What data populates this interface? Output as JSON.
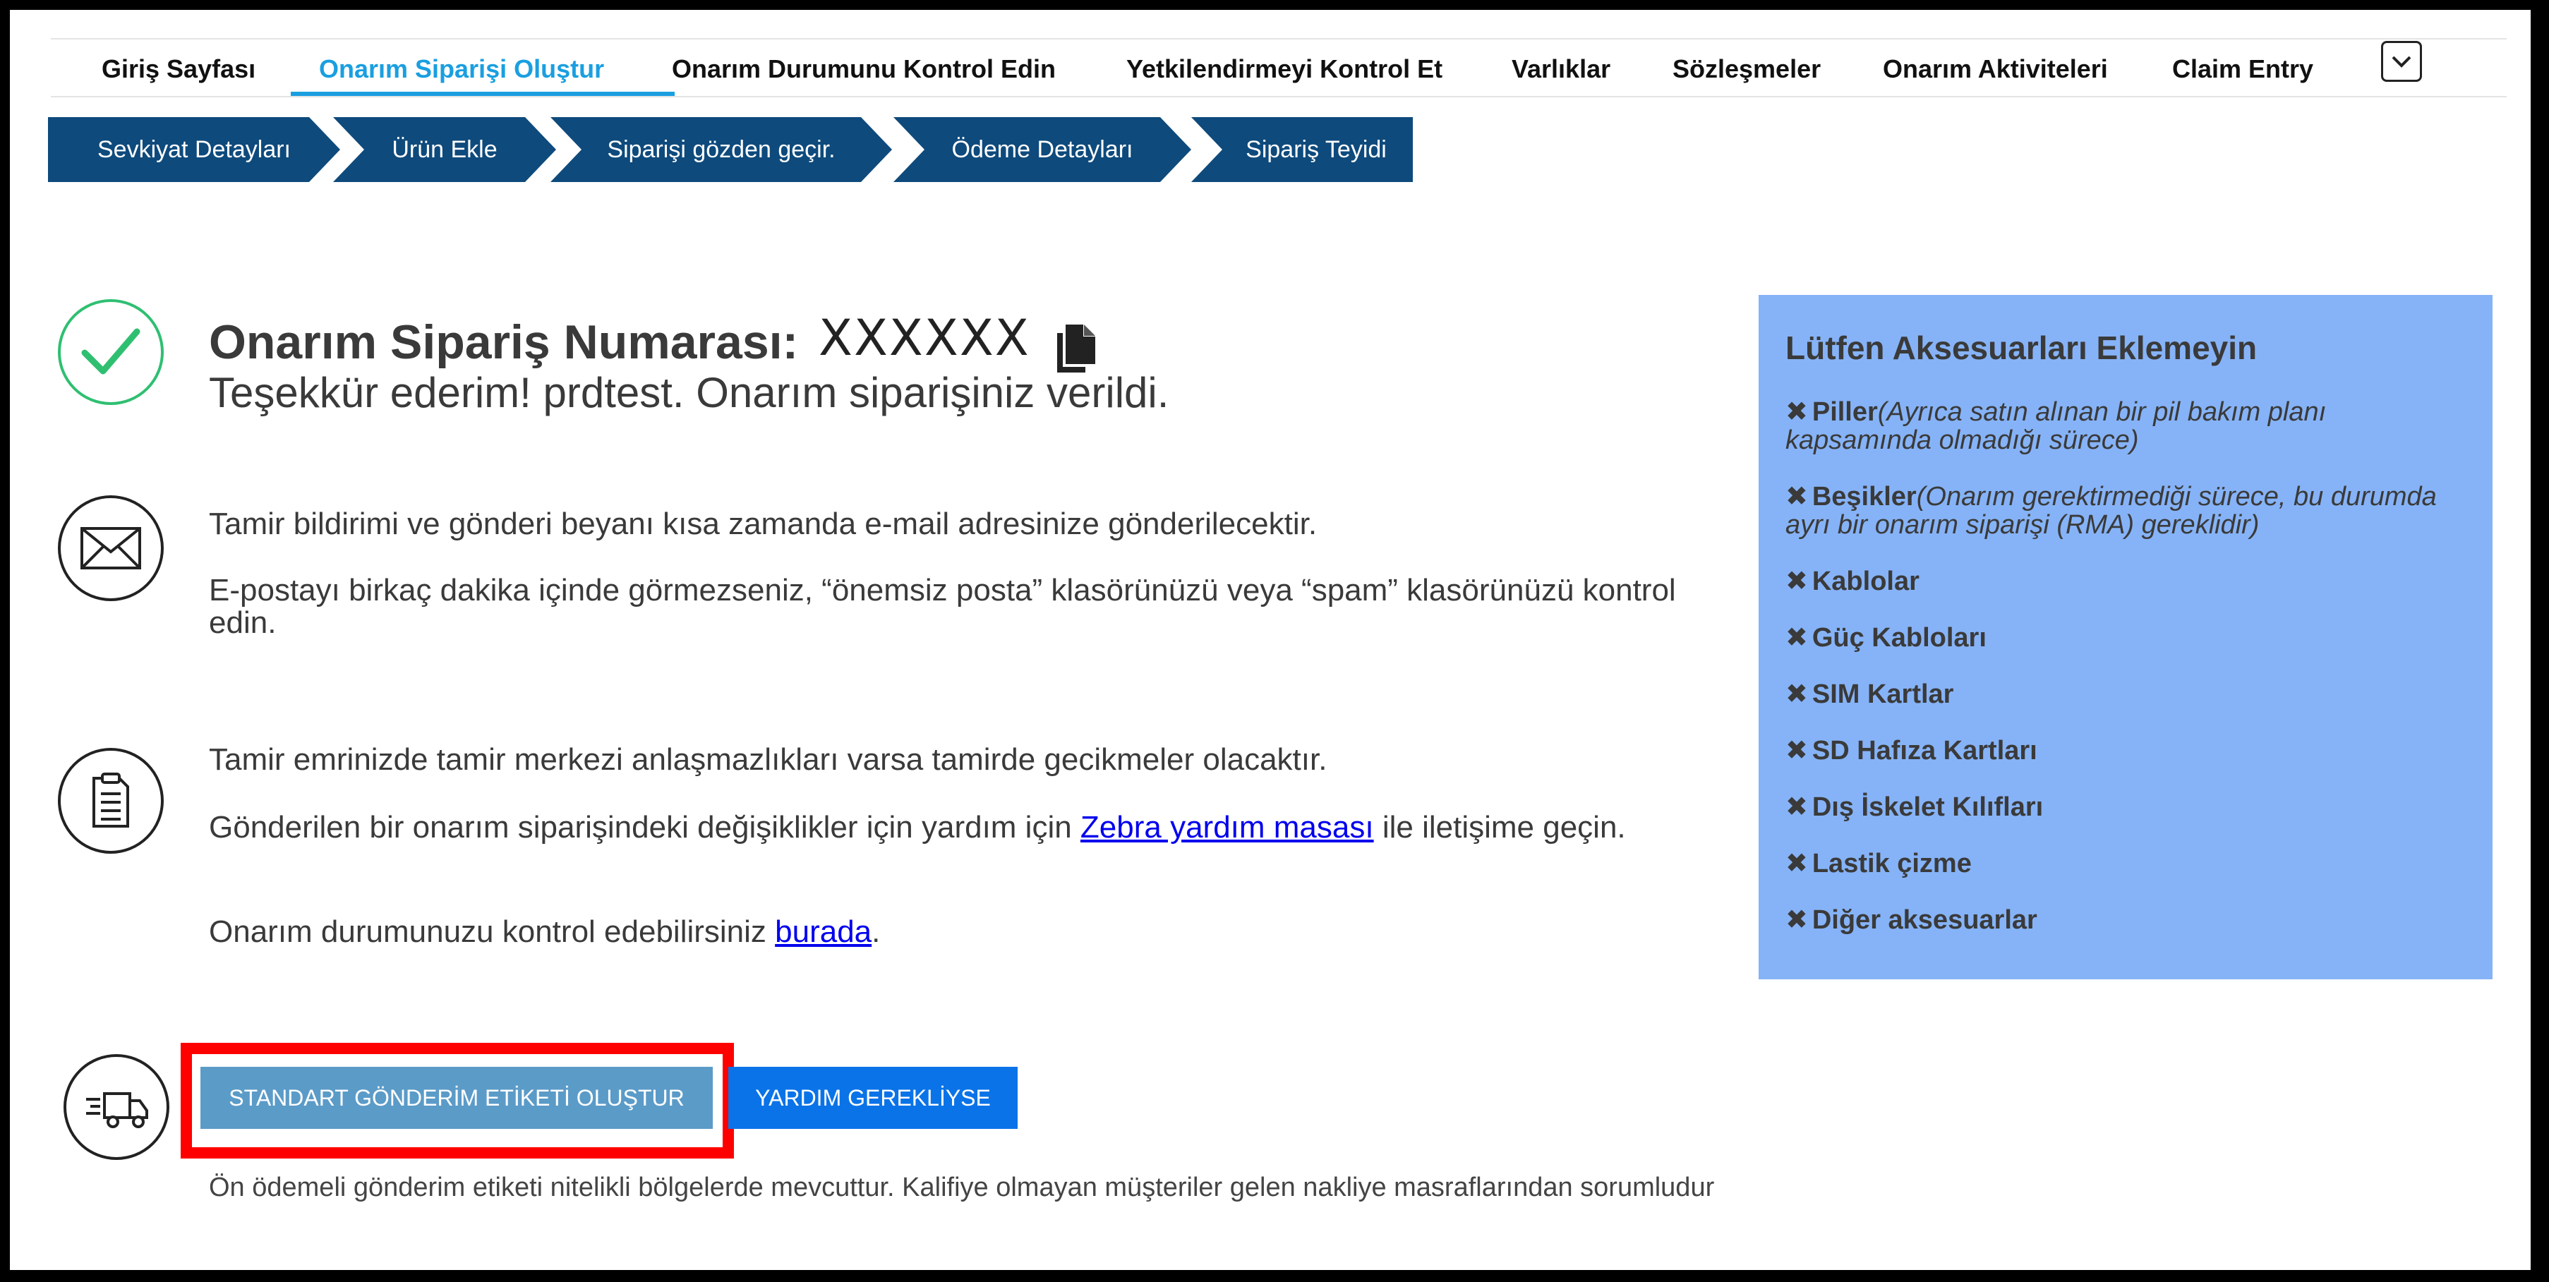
{
  "nav": {
    "items": [
      {
        "label": "Giriş Sayfası"
      },
      {
        "label": "Onarım Siparişi Oluştur"
      },
      {
        "label": "Onarım Durumunu Kontrol Edin"
      },
      {
        "label": "Yetkilendirmeyi Kontrol Et"
      },
      {
        "label": "Varlıklar"
      },
      {
        "label": "Sözleşmeler"
      },
      {
        "label": "Onarım Aktiviteleri"
      },
      {
        "label": "Claim Entry"
      }
    ],
    "active_index": 1,
    "dropdown_icon": "chevron-down-icon"
  },
  "steps": [
    {
      "label": "Sevkiyat Detayları"
    },
    {
      "label": "Ürün Ekle"
    },
    {
      "label": "Siparişi gözden geçir."
    },
    {
      "label": "Ödeme Detayları"
    },
    {
      "label": "Sipariş Teyidi"
    }
  ],
  "confirmation": {
    "order_label": "Onarım Sipariş Numarası:",
    "order_number": "XXXXXX",
    "thanks": "Teşekkür ederim! prdtest. Onarım siparişiniz verildi."
  },
  "email_info": {
    "line1": "Tamir bildirimi ve gönderi beyanı kısa zamanda e-mail adresinize gönderilecektir.",
    "line2": "E-postayı birkaç dakika içinde görmezseniz, “önemsiz posta” klasörünüzü veya “spam” klasörünüzü kontrol edin."
  },
  "repair_info": {
    "line1": "Tamir emrinizde tamir merkezi anlaşmazlıkları varsa tamirde gecikmeler olacaktır.",
    "line2_before": "Gönderilen bir onarım siparişindeki değişiklikler için yardım için ",
    "line2_link": " Zebra yardım masası",
    "line2_after": " ile iletişime geçin.",
    "line3_before": "Onarım durumunuzu kontrol edebilirsiniz ",
    "line3_link": "burada",
    "line3_after": "."
  },
  "accessories": {
    "title": "Lütfen Aksesuarları Eklemeyin",
    "items": [
      {
        "name": "Piller",
        "note": "(Ayrıca satın alınan bir pil bakım planı kapsamında olmadığı sürece)"
      },
      {
        "name": "Beşikler",
        "note": "(Onarım gerektirmediği sürece, bu durumda ayrı bir onarım siparişi (RMA) gereklidir)"
      },
      {
        "name": "Kablolar",
        "note": ""
      },
      {
        "name": "Güç Kabloları",
        "note": ""
      },
      {
        "name": "SIM Kartlar",
        "note": ""
      },
      {
        "name": "SD Hafıza Kartları",
        "note": ""
      },
      {
        "name": "Dış İskelet Kılıfları",
        "note": ""
      },
      {
        "name": "Lastik çizme",
        "note": ""
      },
      {
        "name": "Diğer aksesuarlar",
        "note": ""
      }
    ]
  },
  "actions": {
    "standard_label": "STANDART GÖNDERİM ETİKETİ OLUŞTUR",
    "help_label": "YARDIM GEREKLİYSE",
    "footnote": "Ön ödemeli gönderim etiketi nitelikli bölgelerde mevcuttur. Kalifiye olmayan müşteriler gelen nakliye masraflarından sorumludur"
  },
  "colors": {
    "nav_active": "#1a9fe0",
    "step_bg": "#0e4a7c",
    "panel_bg": "#86b3f7",
    "check_green": "#2fbf71",
    "primary_button": "#0a73e8",
    "standard_button": "#5b9bc8",
    "highlight_frame": "#ff0000"
  }
}
